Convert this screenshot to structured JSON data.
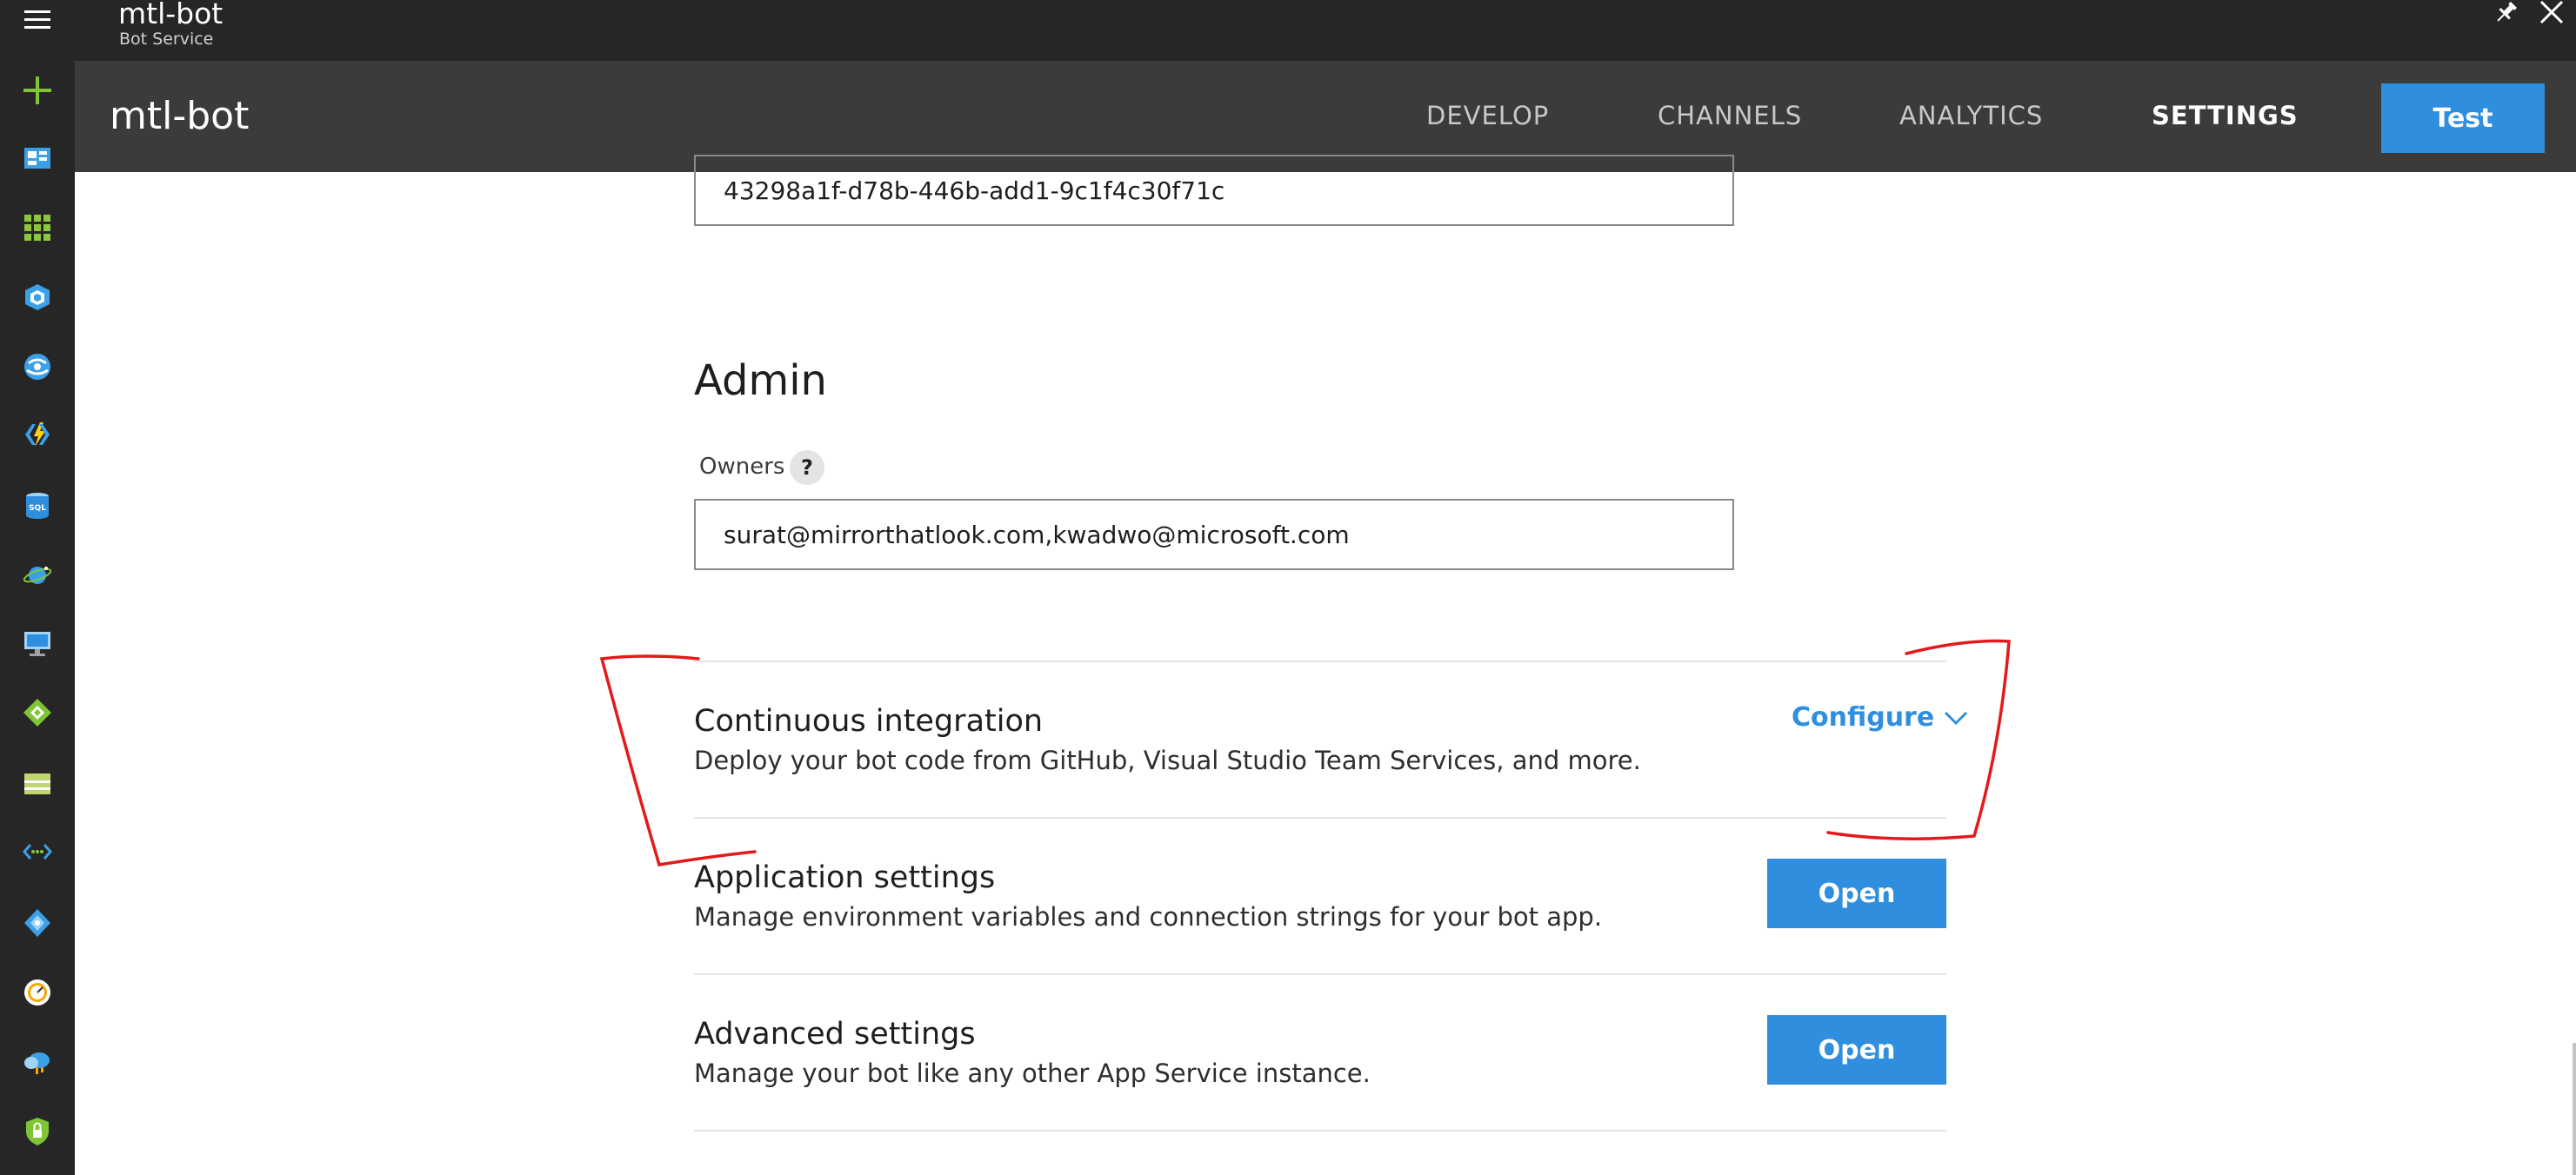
{
  "titlebar": {
    "title": "mtl-bot",
    "subtitle": "Bot Service"
  },
  "header": {
    "name": "mtl-bot",
    "tabs": [
      {
        "label": "DEVELOP",
        "active": false
      },
      {
        "label": "CHANNELS",
        "active": false
      },
      {
        "label": "ANALYTICS",
        "active": false
      },
      {
        "label": "SETTINGS",
        "active": true
      }
    ],
    "test_label": "Test"
  },
  "sidebar": {
    "icons": [
      "hamburger-menu-icon",
      "plus-new-icon",
      "dashboard-icon",
      "all-resources-icon",
      "resource-groups-icon",
      "app-services-icon",
      "function-apps-icon",
      "sql-databases-icon",
      "cosmos-db-icon",
      "virtual-machines-icon",
      "load-balancers-icon",
      "storage-accounts-icon",
      "virtual-networks-icon",
      "azure-ad-icon",
      "monitor-icon",
      "advisor-icon",
      "security-center-icon"
    ]
  },
  "content": {
    "app_id_value": "43298a1f-d78b-446b-add1-9c1f4c30f71c",
    "admin_title": "Admin",
    "owners_label": "Owners",
    "owners_help": "?",
    "owners_value": "surat@mirrorthatlook.com,kwadwo@microsoft.com",
    "ci": {
      "title": "Continuous integration",
      "description": "Deploy your bot code from GitHub, Visual Studio Team Services, and more.",
      "action_label": "Configure"
    },
    "app_settings": {
      "title": "Application settings",
      "description": "Manage environment variables and connection strings for your bot app.",
      "button_label": "Open"
    },
    "advanced_settings": {
      "title": "Advanced settings",
      "description": "Manage your bot like any other App Service instance.",
      "button_label": "Open"
    }
  },
  "colors": {
    "accent": "#2f8fde",
    "sidebar_bg": "#262626",
    "header_bg": "#3b3b3b",
    "annotation": "#e3191b"
  }
}
